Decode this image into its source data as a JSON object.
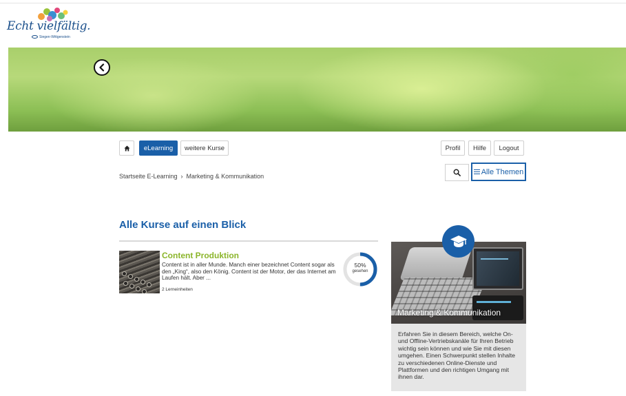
{
  "logo": {
    "text": "Echt vielfältig.",
    "subtext": "Siegen-Wittgenstein",
    "icon": "colorful-blobs-logo-icon"
  },
  "banner": {
    "back_icon": "chevron-left-circle-icon"
  },
  "nav": {
    "home_icon": "home-icon",
    "items": [
      {
        "label": "eLearning",
        "active": true
      },
      {
        "label": "weitere Kurse",
        "active": false
      }
    ],
    "right": {
      "profile": "Profil",
      "help": "Hilfe",
      "logout": "Logout"
    }
  },
  "breadcrumb": {
    "items": [
      "Startseite E-Learning",
      "Marketing & Kommunikation"
    ],
    "separator": "›"
  },
  "toolbar": {
    "search_icon": "search-icon",
    "all_topics_label": "Alle Themen",
    "all_topics_icon": "hamburger-menu-icon"
  },
  "main": {
    "section_title": "Alle Kurse auf einen Blick",
    "courses": [
      {
        "title": "Content Produktion",
        "description": "Content ist in aller Munde. Manch einer bezeichnet Content sogar als den „King“, also den König. Content ist der Motor, der das Internet am Laufen hält. Aber ...",
        "units": "2 Lerneinheiten",
        "progress_percent": 50,
        "progress_text": "50%",
        "progress_label": "gesehen"
      }
    ]
  },
  "topic_card": {
    "badge_icon": "graduation-cap-icon",
    "title": "Marketing & Kommunikation",
    "description": "Erfahren Sie in diesem Bereich, welche On- und Offline-Vertriebskanäle für Ihren Betrieb wichtig sein können und wie Sie mit diesen umgehen. Einen Schwerpunkt stellen Inhalte zu verschiedenen Online-Dienste und Plattformen und den richtigen Umgang mit ihnen dar."
  },
  "colors": {
    "primary": "#1a5fa8",
    "course_title": "#8bb52a",
    "logo_blue": "#1a4f8b"
  }
}
